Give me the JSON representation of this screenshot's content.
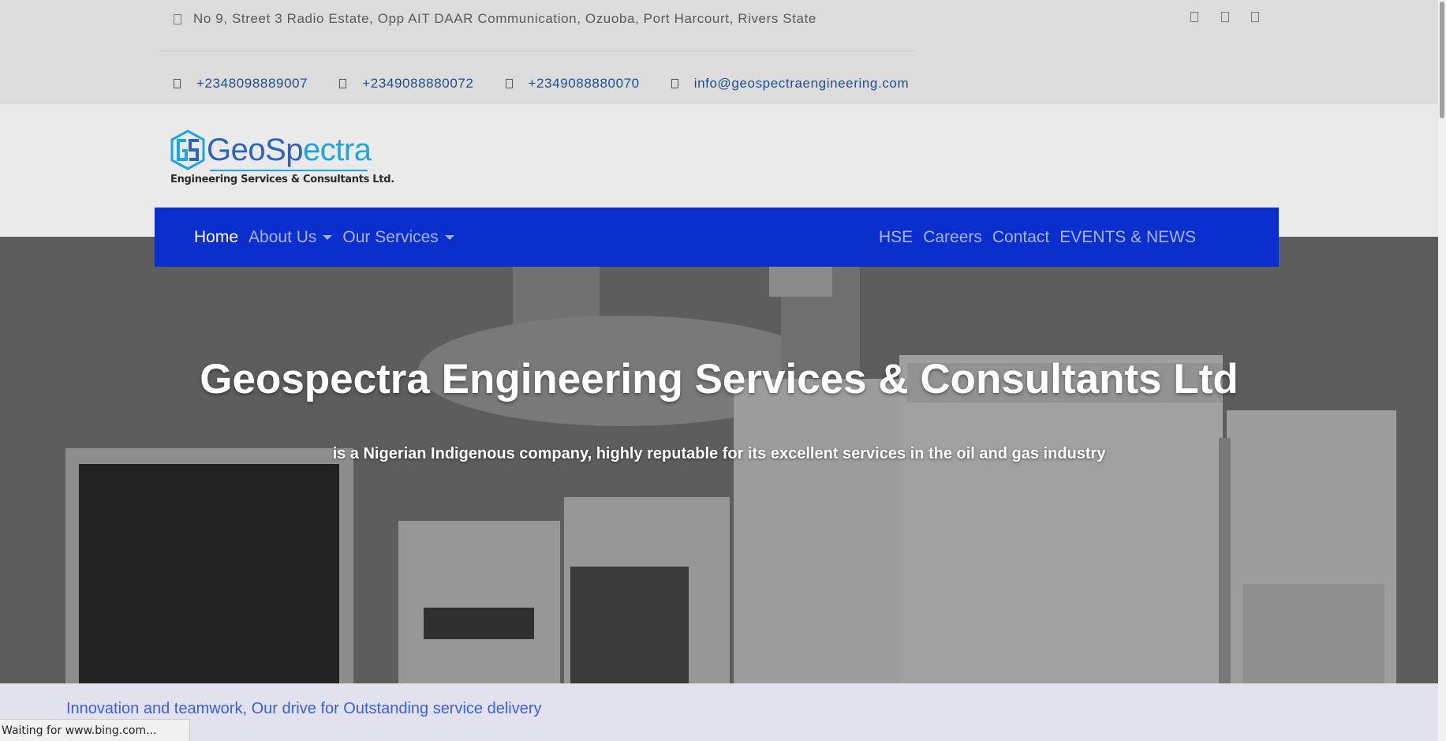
{
  "topbar": {
    "address": "No 9, Street 3 Radio Estate, Opp AIT DAAR Communication, Ozuoba, Port Harcourt, Rivers State",
    "phones": [
      "+2348098889007",
      "+2349088880072",
      "+2349088880070"
    ],
    "email": "info@geospectraengineering.com",
    "social_icons": [
      "social-icon-1",
      "social-icon-2",
      "social-icon-3"
    ]
  },
  "logo": {
    "word_part1": "GeoSp",
    "word_part2": "ectra",
    "subtitle": "Engineering Services & Consultants Ltd."
  },
  "nav": {
    "home": "Home",
    "about": "About Us",
    "services": "Our Services",
    "hse": "HSE",
    "careers": "Careers",
    "contact": "Contact",
    "events": "EVENTS & NEWS"
  },
  "hero": {
    "title": "Geospectra Engineering Services & Consultants Ltd",
    "subtitle": "is a Nigerian Indigenous company, highly reputable for its excellent services in the oil and gas industry"
  },
  "tagline": "Innovation and teamwork, Our drive for Outstanding service delivery",
  "status_bar": "Waiting for www.bing.com...",
  "colors": {
    "nav_bg": "#0b2fcc",
    "nav_active": "#ffffff",
    "nav_link": "#a8b4ee",
    "tagline": "#3a5fe0",
    "contact_text": "#1f4e8c"
  }
}
